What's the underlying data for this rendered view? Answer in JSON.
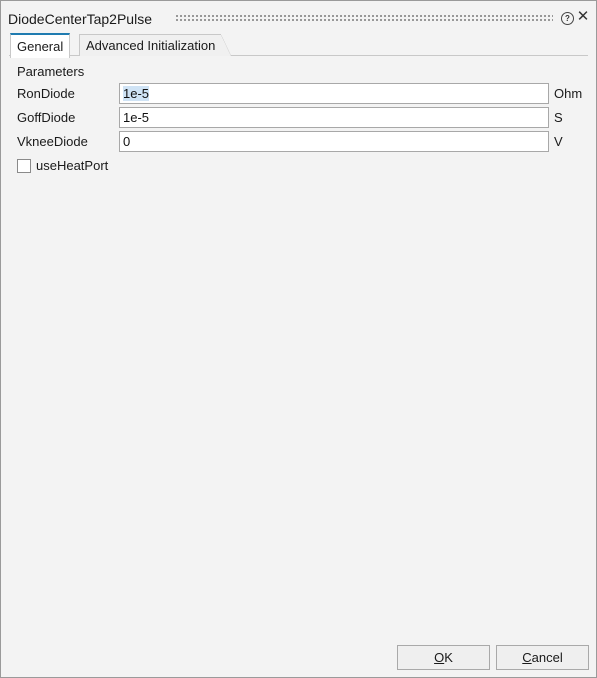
{
  "window": {
    "title": "DiodeCenterTap2Pulse",
    "help_glyph": "?",
    "close_glyph": "✕"
  },
  "tabs": [
    {
      "label": "General",
      "active": true
    },
    {
      "label": "Advanced Initialization",
      "active": false
    }
  ],
  "parameters": {
    "heading": "Parameters",
    "rows": [
      {
        "label": "RonDiode",
        "value": "1e-5",
        "unit": "Ohm"
      },
      {
        "label": "GoffDiode",
        "value": "1e-5",
        "unit": "S"
      },
      {
        "label": "VkneeDiode",
        "value": "0",
        "unit": "V"
      }
    ],
    "use_heat_port": {
      "label": "useHeatPort",
      "checked": false
    }
  },
  "buttons": {
    "ok": {
      "mnemonic": "O",
      "rest": "K"
    },
    "cancel": {
      "mnemonic": "C",
      "rest": "ancel"
    }
  },
  "colors": {
    "accent": "#1f7bb0",
    "background": "#f3f3f3",
    "selection": "#cfe3f5"
  }
}
